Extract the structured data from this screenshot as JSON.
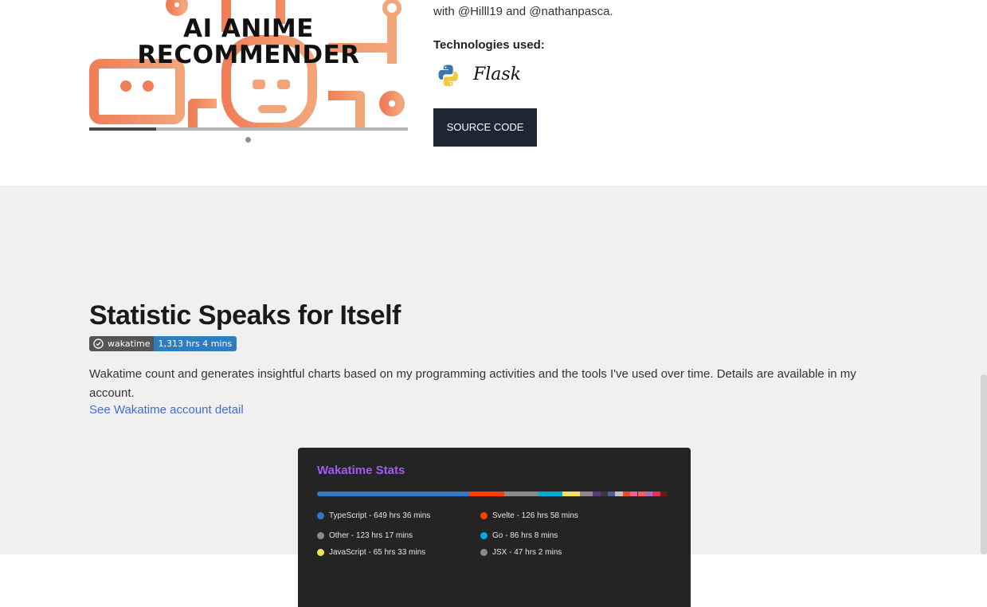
{
  "project": {
    "banner_title_line1": "AI ANIME",
    "banner_title_line2": "RECOMMENDER",
    "carousel_progress": 0.21,
    "description_fragment": "with @Hilll19 and @nathanpasca.",
    "tech_heading": "Technologies used:",
    "tech_icons": [
      "python-icon",
      "flask-icon"
    ],
    "flask_label": "Flask",
    "source_button": "SOURCE CODE"
  },
  "stats": {
    "title": "Statistic Speaks for Itself",
    "badge_label": "wakatime",
    "badge_value": "1,313 hrs 4 mins",
    "description": "Wakatime count and generates insightful charts based on my programming activities and the tools I've used over time. Details are available in my account.",
    "link_text": "See Wakatime account detail",
    "card": {
      "title": "Wakatime Stats",
      "languages": [
        {
          "label": "TypeScript - 649 hrs 36 mins",
          "color": "#3178c6",
          "share": 0.435
        },
        {
          "label": "Svelte - 126 hrs 58 mins",
          "color": "#ff3e00",
          "share": 0.1
        },
        {
          "label": "Other - 123 hrs 17 mins",
          "color": "#8a8a8a",
          "share": 0.097
        },
        {
          "label": "Go - 86 hrs 8 mins",
          "color": "#00add8",
          "share": 0.068
        },
        {
          "label": "JavaScript - 65 hrs 33 mins",
          "color": "#f1e05a",
          "share": 0.05
        },
        {
          "label": "JSX - 47 hrs 2 mins",
          "color": "#8a8a8a",
          "share": 0.037
        }
      ],
      "tail_colors": [
        "#563d7c",
        "#3a3a3a",
        "#4f5d95",
        "#c0c0c0",
        "#e34c26",
        "#f06292",
        "#ff5b5b",
        "#a270ba",
        "#dd3355",
        "#701516"
      ]
    }
  }
}
